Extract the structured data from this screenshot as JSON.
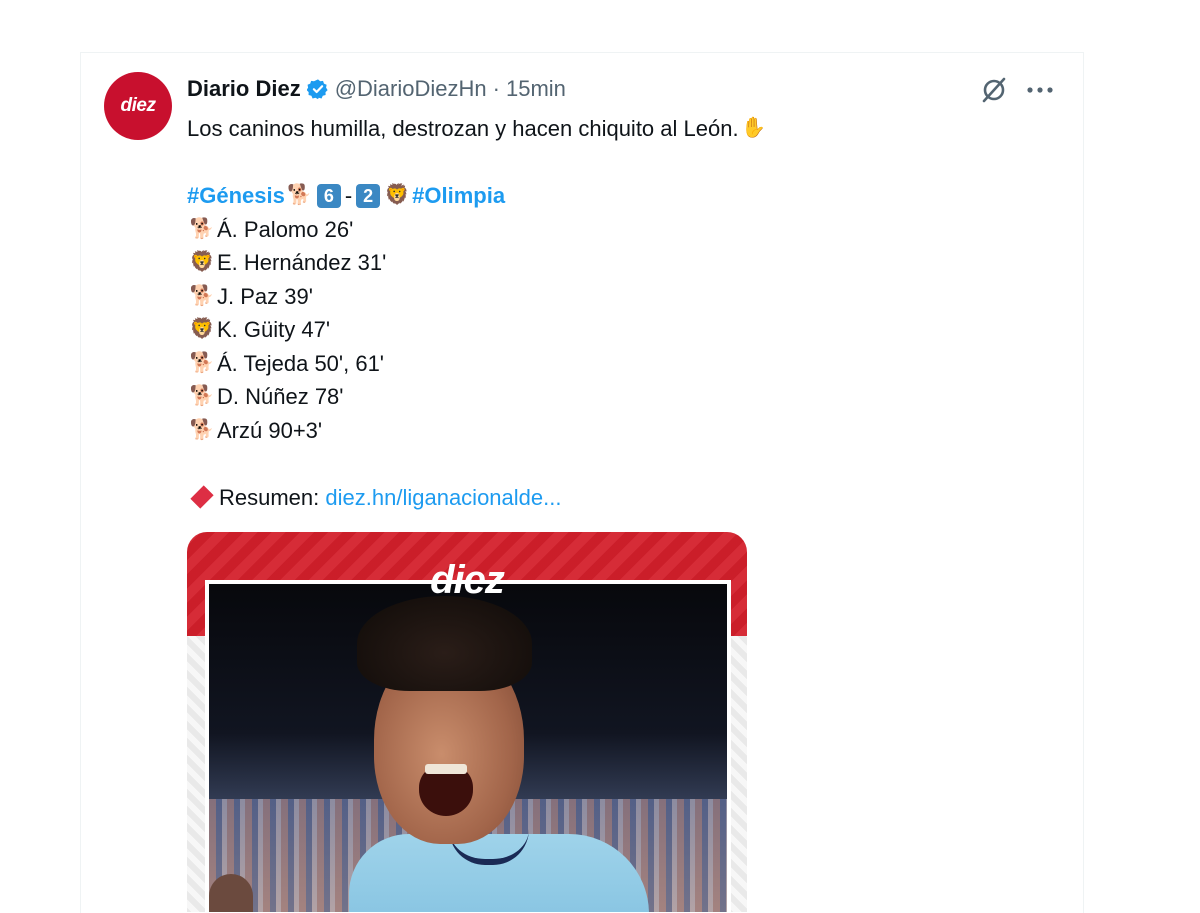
{
  "tweet": {
    "avatar_text": "diez",
    "author_name": "Diario Diez",
    "handle": "@DiarioDiezHn",
    "separator": "·",
    "time": "15min",
    "headline": "Los caninos humilla, destrozan y hacen chiquito al León.",
    "headline_emoji": "✋",
    "score": {
      "home_tag": "#Génesis",
      "home_emoji": "🐕",
      "home_goals": "6",
      "dash": "-",
      "away_goals": "2",
      "away_emoji": "🦁",
      "away_tag": "#Olimpia"
    },
    "scorers": [
      {
        "emoji": "🐕",
        "text": "Á. Palomo 26'"
      },
      {
        "emoji": "🦁",
        "text": "E. Hernández 31'"
      },
      {
        "emoji": "🐕",
        "text": "J. Paz 39'"
      },
      {
        "emoji": "🦁",
        "text": "K. Güity 47'"
      },
      {
        "emoji": "🐕",
        "text": "Á. Tejeda 50', 61'"
      },
      {
        "emoji": "🐕",
        "text": "D. Núñez 78'"
      },
      {
        "emoji": "🐕",
        "text": "Arzú 90+3'"
      }
    ],
    "summary_label": "Resumen:",
    "summary_link": "diez.hn/liganacionalde...",
    "media_logo": "diez"
  },
  "icons": {
    "verified": "verified-badge-icon",
    "grok": "grok-icon",
    "more": "more-options-icon"
  },
  "colors": {
    "brand_red": "#c8102e",
    "link_blue": "#1d9bf0",
    "secondary_text": "#536471"
  }
}
